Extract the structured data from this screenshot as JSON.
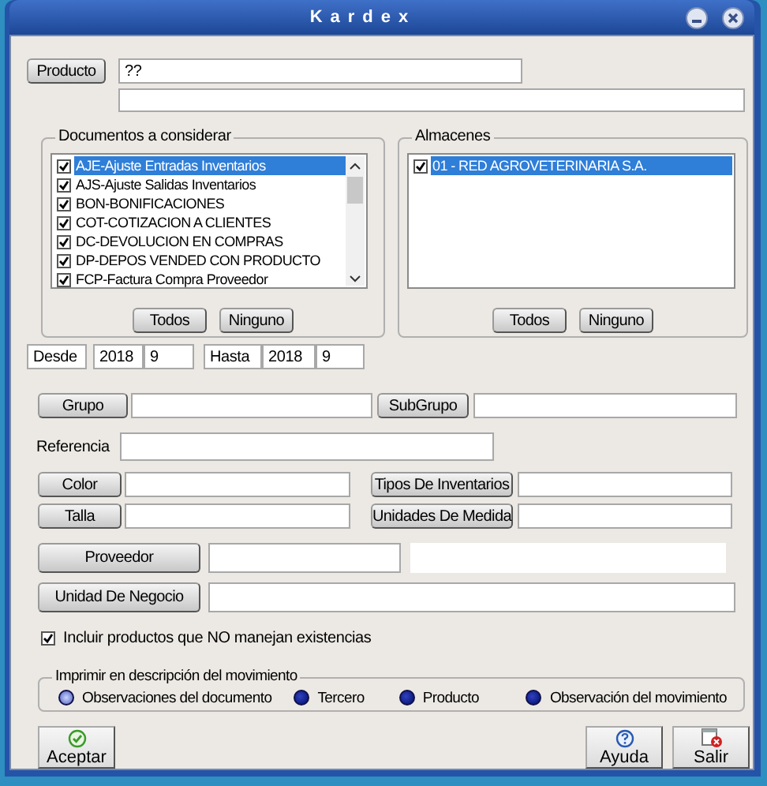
{
  "window": {
    "title": "Kardex"
  },
  "producto": {
    "button": "Producto",
    "value": "??"
  },
  "documentos": {
    "title": "Documentos a considerar",
    "items": [
      {
        "label": "AJE-Ajuste Entradas Inventarios",
        "checked": true,
        "selected": true
      },
      {
        "label": "AJS-Ajuste Salidas Inventarios",
        "checked": true,
        "selected": false
      },
      {
        "label": "BON-BONIFICACIONES",
        "checked": true,
        "selected": false
      },
      {
        "label": "COT-COTIZACION A CLIENTES",
        "checked": true,
        "selected": false
      },
      {
        "label": "DC-DEVOLUCION EN COMPRAS",
        "checked": true,
        "selected": false
      },
      {
        "label": "DP-DEPOS VENDED CON PRODUCTO",
        "checked": true,
        "selected": false
      },
      {
        "label": "FCP-Factura Compra Proveedor",
        "checked": true,
        "selected": false
      }
    ],
    "buttons": [
      "Todos",
      "Ninguno"
    ]
  },
  "almacenes": {
    "title": "Almacenes",
    "items": [
      {
        "label": "01 - RED AGROVETERINARIA S.A.",
        "checked": true,
        "selected": true
      }
    ],
    "buttons": [
      "Todos",
      "Ninguno"
    ]
  },
  "periodo": {
    "desde_label": "Desde",
    "desde_year": "2018",
    "desde_month": "9",
    "hasta_label": "Hasta",
    "hasta_year": "2018",
    "hasta_month": "9"
  },
  "filtros": {
    "grupo": "Grupo",
    "subgrupo": "SubGrupo",
    "referencia": "Referencia",
    "color_button": "Color",
    "talla": "Talla",
    "tipos": "Tipos De Inventarios",
    "unidades": "Unidades De Medida",
    "proveedor": "Proveedor",
    "unidad_negocio": "Unidad De Negocio"
  },
  "incluir": {
    "label": "Incluir productos que NO manejan existencias",
    "checked": true
  },
  "imprimir": {
    "title": "Imprimir en descripción del movimiento",
    "options": [
      {
        "label": "Observaciones del documento",
        "selected": true
      },
      {
        "label": "Tercero",
        "selected": false
      },
      {
        "label": "Producto",
        "selected": false
      },
      {
        "label": "Observación del movimiento",
        "selected": false
      }
    ]
  },
  "actions": [
    {
      "label": "Aceptar",
      "kind": "accept"
    },
    {
      "label": "Ayuda",
      "kind": "help"
    },
    {
      "label": "Salir",
      "kind": "exit"
    }
  ]
}
